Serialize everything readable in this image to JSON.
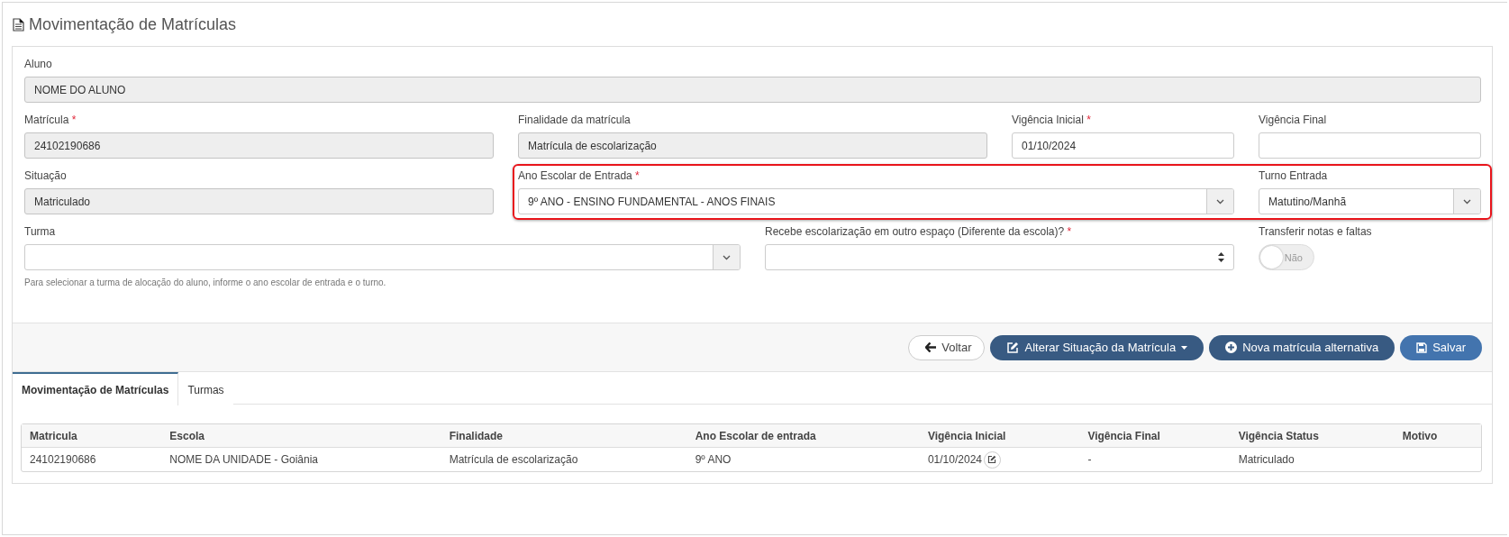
{
  "page": {
    "title": "Movimentação de Matrículas"
  },
  "form": {
    "rows": [
      {
        "fields": [
          {
            "kind": "text",
            "label": "Aluno",
            "value": "NOME DO ALUNO",
            "disabled": true
          }
        ]
      },
      {
        "fields": [
          {
            "kind": "text",
            "label": "Matrícula",
            "required_mark": "*",
            "value": "24102190686",
            "disabled": true
          },
          {
            "kind": "text",
            "label": "Finalidade da matrícula",
            "value": "Matrícula de escolarização",
            "disabled": true
          },
          {
            "kind": "text",
            "label": "Vigência Inicial",
            "required_mark": "*",
            "value": "01/10/2024",
            "disabled": false
          },
          {
            "kind": "text",
            "label": "Vigência Final",
            "disabled": false
          }
        ]
      },
      {
        "fields": [
          {
            "kind": "text",
            "label": "Situação",
            "value": "Matriculado",
            "disabled": true
          },
          {
            "kind": "highlight-group",
            "fields": [
              {
                "kind": "select",
                "label": "Ano Escolar de Entrada",
                "required_mark": "*",
                "value": "9º ANO - ENSINO FUNDAMENTAL - ANOS FINAIS",
                "disabled": false
              },
              {
                "kind": "select",
                "label": "Turno Entrada",
                "value": "Matutino/Manhã",
                "disabled": false
              }
            ]
          }
        ]
      },
      {
        "fields": [
          {
            "kind": "select",
            "label": "Turma",
            "disabled": false,
            "hint": "Para selecionar a turma de alocação do aluno, informe o ano escolar de entrada e o turno."
          },
          {
            "kind": "spinner",
            "label": "Recebe escolarização em outro espaço (Diferente da escola)?",
            "required_mark": "*",
            "disabled": false
          },
          {
            "kind": "toggle",
            "label": "Transferir notas e faltas",
            "value": "Não",
            "on": false
          }
        ]
      }
    ]
  },
  "buttons": [
    {
      "kind": "back",
      "label": "Voltar"
    },
    {
      "kind": "menu",
      "label": "Alterar Situação da Matrícula"
    },
    {
      "kind": "add",
      "label": "Nova matrícula alternativa"
    },
    {
      "kind": "save",
      "label": "Salvar"
    }
  ],
  "tabs": [
    {
      "label": "Movimentação de Matrículas",
      "selected": true
    },
    {
      "label": "Turmas",
      "selected": false
    }
  ],
  "table": {
    "columns": [
      "Matricula",
      "Escola",
      "Finalidade",
      "Ano Escolar de entrada",
      "Vigência Inicial",
      "Vigência Final",
      "Vigência Status",
      "Motivo"
    ],
    "rows": [
      {
        "cells": [
          {
            "text": "24102190686",
            "edit": false
          },
          {
            "text": "NOME DA UNIDADE - Goiânia",
            "edit": false
          },
          {
            "text": "Matrícula de escolarização",
            "edit": false
          },
          {
            "text": "9º ANO",
            "edit": false
          },
          {
            "text": "01/10/2024",
            "edit": true
          },
          {
            "text": "-",
            "edit": false
          },
          {
            "text": "Matriculado",
            "edit": false
          }
        ]
      }
    ]
  }
}
